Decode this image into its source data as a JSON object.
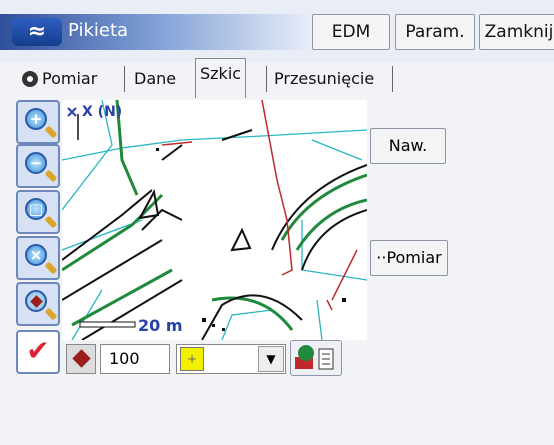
{
  "titlebar": {
    "title": "Pikieta",
    "buttons": {
      "edm": "EDM",
      "param": "Param.",
      "close": "Zamknij"
    }
  },
  "tabs": [
    {
      "label": "Pomiar"
    },
    {
      "label": "Dane"
    },
    {
      "label": "Szkic",
      "active": true
    },
    {
      "label": "Przesunięcie"
    }
  ],
  "map": {
    "north_label": "X (N)",
    "scale_label": "20 m"
  },
  "side_buttons": {
    "naw": "Naw.",
    "pomiar": "Pomiar"
  },
  "tools": [
    "zoom-in-icon",
    "zoom-out-icon",
    "zoom-window-icon",
    "zoom-extents-icon",
    "zoom-point-icon"
  ],
  "bottom": {
    "scale_value": "100",
    "color_swatch": "#f2f000",
    "marker_color": "#9b1d1d"
  },
  "colors": {
    "titlebar_start": "#2f4f9a",
    "map_road": "#111111",
    "map_green": "#1f8a3c",
    "map_cyan": "#27b7c4",
    "map_red": "#c0282c"
  }
}
